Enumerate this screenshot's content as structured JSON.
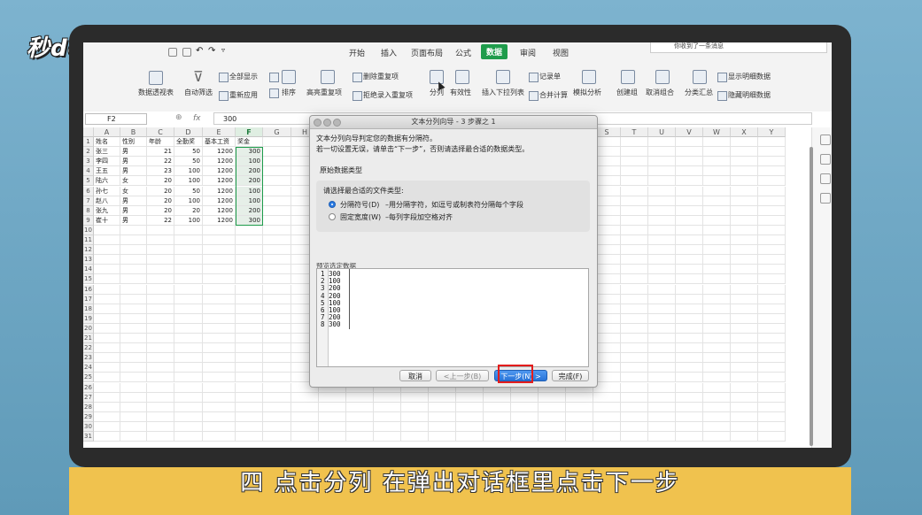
{
  "logo_text": "秒dong视频",
  "caption": "四 点击分列 在弹出对话框里点击下一步",
  "notification": "你收到了一条消息",
  "menu": [
    "开始",
    "插入",
    "页面布局",
    "公式",
    "数据",
    "审阅",
    "视图"
  ],
  "menu_active": "数据",
  "ribbon": {
    "pivot": "数据透视表",
    "autofilter": "自动筛选",
    "showall": "全部显示",
    "reapply": "重新应用",
    "sort": "排序",
    "highlight_dup": "高亮重复项",
    "remove_dup": "删除重复项",
    "reject_dup": "拒绝录入重复项",
    "split": "分列",
    "validity": "有效性",
    "dropdown": "插入下拉列表",
    "record": "记录单",
    "consolidate": "合并计算",
    "simulate": "模拟分析",
    "group": "创建组",
    "ungroup": "取消组合",
    "subtotal": "分类汇总",
    "show_detail": "显示明细数据",
    "hide_detail": "隐藏明细数据"
  },
  "formula_bar": {
    "cell_ref": "F2",
    "fx": "fx",
    "value": "300"
  },
  "columns": [
    "A",
    "B",
    "C",
    "D",
    "E",
    "F",
    "G",
    "H",
    "I",
    "J",
    "K",
    "L",
    "M",
    "N",
    "O",
    "P",
    "Q",
    "R",
    "S",
    "T",
    "U",
    "V",
    "W",
    "X",
    "Y"
  ],
  "rows": [
    "1",
    "2",
    "3",
    "4",
    "5",
    "6",
    "7",
    "8",
    "9",
    "10",
    "11",
    "12",
    "13",
    "14",
    "15",
    "16",
    "17",
    "18",
    "19",
    "20",
    "21",
    "22",
    "23",
    "24",
    "25",
    "26",
    "27",
    "28",
    "29",
    "30",
    "31"
  ],
  "headers": [
    "姓名",
    "性别",
    "年龄",
    "全勤奖",
    "基本工资",
    "奖金"
  ],
  "table": [
    [
      "张三",
      "男",
      "21",
      "50",
      "1200",
      "300"
    ],
    [
      "李四",
      "男",
      "22",
      "50",
      "1200",
      "100"
    ],
    [
      "王五",
      "男",
      "23",
      "100",
      "1200",
      "200"
    ],
    [
      "陆六",
      "女",
      "20",
      "100",
      "1200",
      "200"
    ],
    [
      "孙七",
      "女",
      "20",
      "50",
      "1200",
      "100"
    ],
    [
      "赵八",
      "男",
      "20",
      "100",
      "1200",
      "100"
    ],
    [
      "张九",
      "男",
      "20",
      "20",
      "1200",
      "200"
    ],
    [
      "崔十",
      "男",
      "22",
      "100",
      "1200",
      "300"
    ]
  ],
  "dialog": {
    "title": "文本分列向导 - 3 步骤之 1",
    "line1": "文本分列向导判定您的数据有分隔符。",
    "line2": "若一切设置无误，请单击“下一步”，否则请选择最合适的数据类型。",
    "section": "原始数据类型",
    "choose_label": "请选择最合适的文件类型:",
    "option1_label": "分隔符号(D)",
    "option1_desc": "–用分隔字符，如逗号或制表符分隔每个字段",
    "option2_label": "固定宽度(W)",
    "option2_desc": "–每列字段加空格对齐",
    "preview_label": "预览选定数据",
    "preview_lines": [
      "1 300",
      "2 100",
      "3 200",
      "4 200",
      "5 100",
      "6 100",
      "7 200",
      "8 300"
    ],
    "btn_cancel": "取消",
    "btn_prev": "<上一步(B)",
    "btn_next": "下一步(N) >",
    "btn_finish": "完成(F)"
  }
}
